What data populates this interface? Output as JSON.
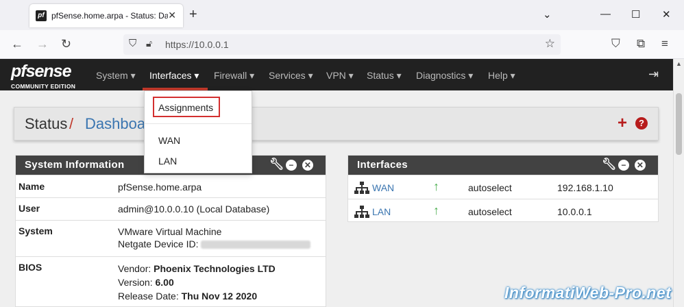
{
  "browser": {
    "favicon_text": "pf",
    "tab_title": "pfSense.home.arpa - Status: Dashboard",
    "url": "https://10.0.0.1"
  },
  "nav": {
    "logo_main": "pfsense",
    "logo_sub": "COMMUNITY EDITION",
    "menu": [
      {
        "label": "System ▾"
      },
      {
        "label": "Interfaces ▾"
      },
      {
        "label": "Firewall ▾"
      },
      {
        "label": "Services ▾"
      },
      {
        "label": "VPN ▾"
      },
      {
        "label": "Status ▾"
      },
      {
        "label": "Diagnostics ▾"
      },
      {
        "label": "Help ▾"
      }
    ],
    "active_menu": "Interfaces"
  },
  "dropdown": {
    "items": [
      "Assignments",
      "WAN",
      "LAN"
    ],
    "highlight_color": "#d32f2f"
  },
  "breadcrumb": {
    "status": "Status",
    "separator": "/",
    "page": "Dashboard"
  },
  "system_info": {
    "title": "System Information",
    "rows": [
      {
        "key": "Name",
        "lines": [
          "pfSense.home.arpa"
        ]
      },
      {
        "key": "User",
        "lines": [
          "admin@10.0.0.10 (Local Database)"
        ]
      },
      {
        "key": "System",
        "lines": [
          "VMware Virtual Machine",
          "Netgate Device ID:"
        ]
      },
      {
        "key": "BIOS",
        "lines": [
          "Vendor: ",
          "Version: ",
          "Release Date: "
        ],
        "bold": [
          "Phoenix Technologies LTD",
          "6.00",
          "Thu Nov 12 2020"
        ]
      }
    ]
  },
  "interfaces": {
    "title": "Interfaces",
    "rows": [
      {
        "name": "WAN",
        "status": "up",
        "media": "autoselect",
        "ip": "192.168.1.10"
      },
      {
        "name": "LAN",
        "status": "up",
        "media": "autoselect",
        "ip": "10.0.0.1"
      }
    ]
  },
  "colors": {
    "navbar": "#212121",
    "accent_red": "#b71c1c",
    "link_blue": "#3a75b0",
    "status_up": "#4caf50"
  },
  "watermark": "InformatiWeb-Pro.net"
}
